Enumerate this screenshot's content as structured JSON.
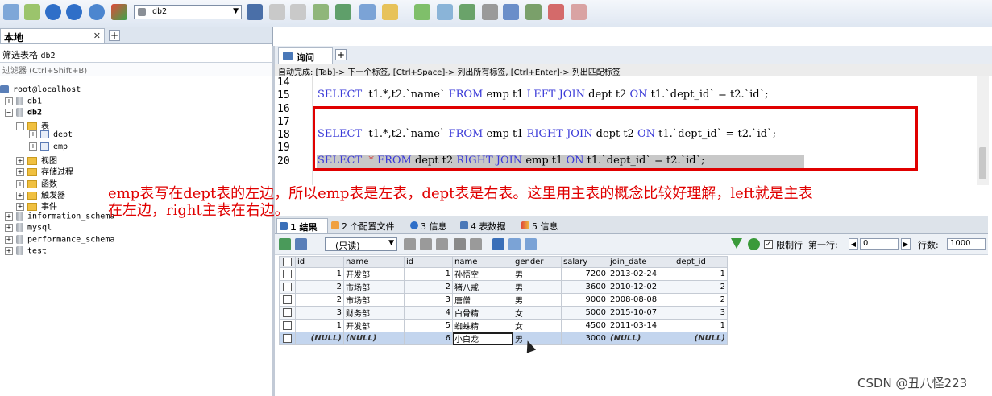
{
  "toolbar": {
    "db_selected": "db2",
    "icons": [
      "connect-icon",
      "disconnect-icon",
      "run-icon",
      "run-all-icon",
      "refresh-icon",
      "favorites-icon",
      "user-icon",
      "backup-icon",
      "restore-icon",
      "import-icon",
      "export-icon",
      "schema-icon",
      "designer-icon",
      "sync-icon",
      "compare-icon",
      "query-builder-icon",
      "history-icon",
      "notifications-icon",
      "table-data-icon",
      "settings-icon"
    ]
  },
  "left": {
    "tab_label": "本地",
    "filter_title": "筛选表格",
    "filter_db": "db2",
    "filter_placeholder": "过滤器 (Ctrl+Shift+B)",
    "tree": [
      {
        "label": "root@localhost",
        "type": "user"
      },
      {
        "label": "db1",
        "type": "db",
        "toggle": "+"
      },
      {
        "label": "db2",
        "type": "db",
        "toggle": "−",
        "bold": true
      },
      {
        "label": "表",
        "type": "folder",
        "toggle": "−"
      },
      {
        "label": "dept",
        "type": "table",
        "toggle": "+"
      },
      {
        "label": "emp",
        "type": "table",
        "toggle": "+"
      },
      {
        "label": "视图",
        "type": "folder",
        "toggle": "+"
      },
      {
        "label": "存储过程",
        "type": "folder",
        "toggle": "+"
      },
      {
        "label": "函数",
        "type": "folder",
        "toggle": "+"
      },
      {
        "label": "触发器",
        "type": "folder",
        "toggle": "+"
      },
      {
        "label": "事件",
        "type": "folder",
        "toggle": "+"
      },
      {
        "label": "information_schema",
        "type": "db",
        "toggle": "+"
      },
      {
        "label": "mysql",
        "type": "db",
        "toggle": "+"
      },
      {
        "label": "performance_schema",
        "type": "db",
        "toggle": "+"
      },
      {
        "label": "test",
        "type": "db",
        "toggle": "+"
      }
    ]
  },
  "query": {
    "tab_label": "询问",
    "autocomplete_hint": "自动完成: [Tab]-> 下一个标签, [Ctrl+Space]-> 列出所有标签, [Ctrl+Enter]-> 列出匹配标签",
    "lines": [
      {
        "n": "14",
        "code": ""
      },
      {
        "n": "15",
        "code": "SELECT  t1.*,t2.`name` FROM emp t1 LEFT JOIN dept t2 ON t1.`dept_id` = t2.`id`;"
      },
      {
        "n": "16",
        "code": ""
      },
      {
        "n": "17",
        "code": ""
      },
      {
        "n": "18",
        "code": "SELECT  t1.*,t2.`name` FROM emp t1 RIGHT JOIN dept t2 ON t1.`dept_id` = t2.`id`;"
      },
      {
        "n": "19",
        "code": ""
      },
      {
        "n": "20",
        "code": "SELECT  * FROM dept t2 RIGHT JOIN emp t1 ON t1.`dept_id` = t2.`id`;"
      }
    ]
  },
  "annotation": {
    "line1": "emp表写在dept表的左边，所以emp表是左表，dept表是右表。这里用主表的概念比较好理解，left就是主表",
    "line2": "在左边，right主表在右边。"
  },
  "results_tabs": [
    {
      "label": "1 结果",
      "active": true
    },
    {
      "label": "2 个配置文件"
    },
    {
      "label": "3 信息"
    },
    {
      "label": "4 表数据"
    },
    {
      "label": "5 信息"
    }
  ],
  "results_toolbar": {
    "mode": "(只读)",
    "limit_label": "限制行",
    "limit_checked": "✓",
    "first_row_label": "第一行:",
    "first_row_value": "0",
    "rows_label": "行数:",
    "rows_value": "1000"
  },
  "grid": {
    "columns": [
      "id",
      "name",
      "id",
      "name",
      "gender",
      "salary",
      "join_date",
      "dept_id"
    ],
    "rows": [
      [
        "1",
        "开发部",
        "1",
        "孙悟空",
        "男",
        "7200",
        "2013-02-24",
        "1"
      ],
      [
        "2",
        "市场部",
        "2",
        "猪八戒",
        "男",
        "3600",
        "2010-12-02",
        "2"
      ],
      [
        "2",
        "市场部",
        "3",
        "唐僧",
        "男",
        "9000",
        "2008-08-08",
        "2"
      ],
      [
        "3",
        "财务部",
        "4",
        "白骨精",
        "女",
        "5000",
        "2015-10-07",
        "3"
      ],
      [
        "1",
        "开发部",
        "5",
        "蜘蛛精",
        "女",
        "4500",
        "2011-03-14",
        "1"
      ],
      [
        "(NULL)",
        "(NULL)",
        "6",
        "小白龙",
        "男",
        "3000",
        "(NULL)",
        "(NULL)"
      ]
    ]
  },
  "watermark": "CSDN @丑八怪223",
  "colors": {
    "keyword": "#3a3ad8",
    "redbox": "#e00000",
    "annotation": "#e00000"
  }
}
